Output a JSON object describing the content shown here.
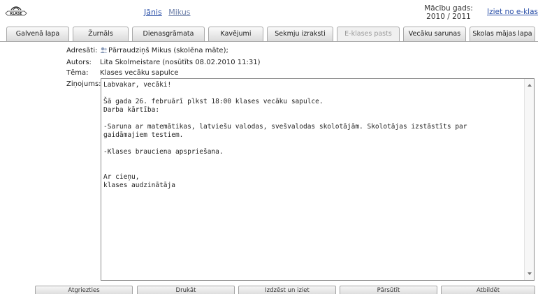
{
  "header": {
    "logo_icon": "klase-logo",
    "user_first": "Jānis",
    "user_last": "Mikus",
    "year_label": "Mācību gads:",
    "year_value": "2010 / 2011",
    "logout": "Iziet no e-klases"
  },
  "tabs": [
    {
      "label": "Galvenā lapa",
      "active": false
    },
    {
      "label": "Žurnāls",
      "active": false
    },
    {
      "label": "Dienasgrāmata",
      "active": false
    },
    {
      "label": "Kavējumi",
      "active": false
    },
    {
      "label": "Sekmju izraksti",
      "active": false
    },
    {
      "label": "E-klases pasts",
      "active": true
    },
    {
      "label": "Vecāku sarunas",
      "active": false
    },
    {
      "label": "Skolas mājas lapa",
      "active": false
    }
  ],
  "message": {
    "recipients_label": "Adresāti:",
    "recipients_value": "Pārraudziņš Mikus (skolēna māte);",
    "author_label": "Autors:",
    "author_value": "Lita Skolmeistare (nosūtīts 08.02.2010 11:31)",
    "subject_label": "Tēma:",
    "subject_value": "Klases vecāku sapulce",
    "body_label": "Ziņojums:",
    "body_text": "Labvakar, vecāki!\n\nŠā gada 26. februārī plkst 18:00 klases vecāku sapulce.\nDarba kārtība:\n\n-Saruna ar matemātikas, latviešu valodas, svešvalodas skolotājām. Skolotājas izstāstīts par\ngaidāmajiem testiem.\n\n-Klases brauciena apspriešana.\n\n\nAr cieņu,\nklases audzinātāja"
  },
  "buttons": {
    "back": "Atgriezties",
    "print": "Drukāt",
    "delete": "Izdzēst un iziet",
    "forward": "Pārsūtīt",
    "reply": "Atbildēt"
  }
}
